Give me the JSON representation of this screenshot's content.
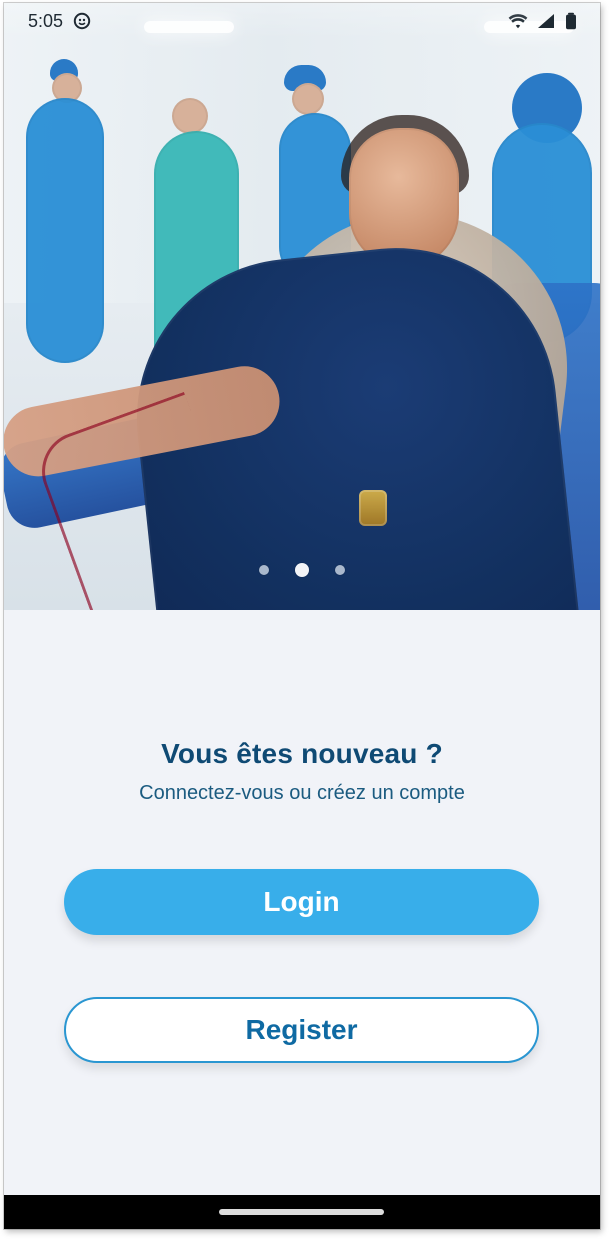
{
  "status_bar": {
    "time": "5:05",
    "left_icons": [
      "app-notification-icon"
    ],
    "right_icons": [
      "wifi-icon",
      "cellular-icon",
      "battery-icon"
    ]
  },
  "carousel": {
    "dots": [
      {
        "active": false
      },
      {
        "active": true
      },
      {
        "active": false
      }
    ]
  },
  "main": {
    "title": "Vous êtes nouveau ?",
    "subtitle": "Connectez-vous ou créez un compte",
    "login_label": "Login",
    "register_label": "Register"
  },
  "colors": {
    "title": "#0f4a74",
    "subtitle": "#1b5b80",
    "primary_button": "#38aeea",
    "secondary_text": "#0f6aa3",
    "secondary_border": "#2a96d1",
    "background": "#f1f3f8"
  }
}
